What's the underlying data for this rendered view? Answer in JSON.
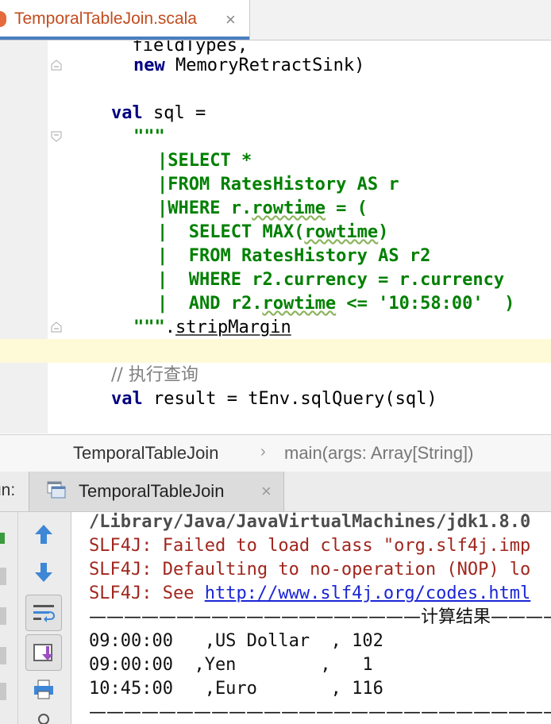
{
  "editor_tab": {
    "title": "TemporalTableJoin.scala",
    "close": "×"
  },
  "code_lines": [
    {
      "parts": [
        {
          "t": "  fieldTypes,",
          "c": "plain"
        }
      ]
    },
    {
      "parts": [
        {
          "t": "new",
          "c": "kw"
        },
        {
          "t": " MemoryRetractSink)",
          "c": "plain"
        }
      ]
    },
    {
      "parts": []
    },
    {
      "parts": [
        {
          "t": "val",
          "c": "kw"
        },
        {
          "t": " sql =",
          "c": "plain"
        }
      ]
    },
    {
      "parts": [
        {
          "t": "\"\"\"",
          "c": "str"
        }
      ]
    },
    {
      "parts": [
        {
          "t": "|SELECT *",
          "c": "str"
        }
      ]
    },
    {
      "parts": [
        {
          "t": "|FROM RatesHistory AS r",
          "c": "str"
        }
      ]
    },
    {
      "parts": [
        {
          "t": "|WHERE r.",
          "c": "str"
        },
        {
          "t": "rowtime",
          "c": "str squig"
        },
        {
          "t": " = (",
          "c": "str"
        }
      ]
    },
    {
      "parts": [
        {
          "t": "|  SELECT MAX(",
          "c": "str"
        },
        {
          "t": "rowtime",
          "c": "str squig"
        },
        {
          "t": ")",
          "c": "str"
        }
      ]
    },
    {
      "parts": [
        {
          "t": "|  FROM RatesHistory AS r2",
          "c": "str"
        }
      ]
    },
    {
      "parts": [
        {
          "t": "|  WHERE r2.currency = r.currency",
          "c": "str"
        }
      ]
    },
    {
      "parts": [
        {
          "t": "|  AND r2.",
          "c": "str"
        },
        {
          "t": "rowtime",
          "c": "str squig"
        },
        {
          "t": " <= '10:58:00'  )",
          "c": "str"
        }
      ]
    },
    {
      "parts": [
        {
          "t": "\"\"\"",
          "c": "str"
        },
        {
          "t": ".",
          "c": "plain"
        },
        {
          "t": "stripMargin",
          "c": "plain ul"
        }
      ]
    },
    {
      "parts": []
    },
    {
      "parts": [
        {
          "t": "// 执行查询",
          "c": "cmt"
        }
      ]
    },
    {
      "parts": [
        {
          "t": "val",
          "c": "kw"
        },
        {
          "t": " result = tEnv.sqlQuery(sql)",
          "c": "plain"
        }
      ]
    }
  ],
  "breadcrumb": {
    "class_name": "TemporalTableJoin",
    "separator": "›",
    "method": "main(args: Array[String])"
  },
  "run_window": {
    "label": "un:",
    "tab_title": "TemporalTableJoin",
    "close": "×"
  },
  "tools": [
    {
      "name": "up-arrow-icon"
    },
    {
      "name": "down-arrow-icon"
    },
    {
      "name": "soft-wrap-icon"
    },
    {
      "name": "scroll-to-end-icon"
    },
    {
      "name": "print-icon"
    }
  ],
  "console_lines": [
    {
      "text": "/Library/Java/JavaVirtualMachines/jdk1.8.0",
      "c": "path"
    },
    {
      "text": "SLF4J: Failed to load class \"org.slf4j.imp",
      "c": "err"
    },
    {
      "text": "SLF4J: Defaulting to no-operation (NOP) lo",
      "c": "err"
    },
    {
      "text": "SLF4J: See ",
      "c": "err",
      "link": "http://www.slf4j.org/codes.html"
    },
    {
      "text": "———————————————————计算结果———————————",
      "c": "out cjk"
    },
    {
      "text": "09:00:00   ,US Dollar  , 102",
      "c": "out"
    },
    {
      "text": "09:00:00  ,Yen        ,   1",
      "c": "out"
    },
    {
      "text": "10:45:00   ,Euro       , 116",
      "c": "out"
    },
    {
      "text": "——————————————————————————————",
      "c": "out cjk"
    }
  ],
  "colors": {
    "keyword": "#000080",
    "string": "#008000",
    "comment": "#808080",
    "error": "#a0261e",
    "link": "#1a25d6",
    "caret_line": "#fefad8",
    "tab_accent": "#4a7ebf"
  }
}
